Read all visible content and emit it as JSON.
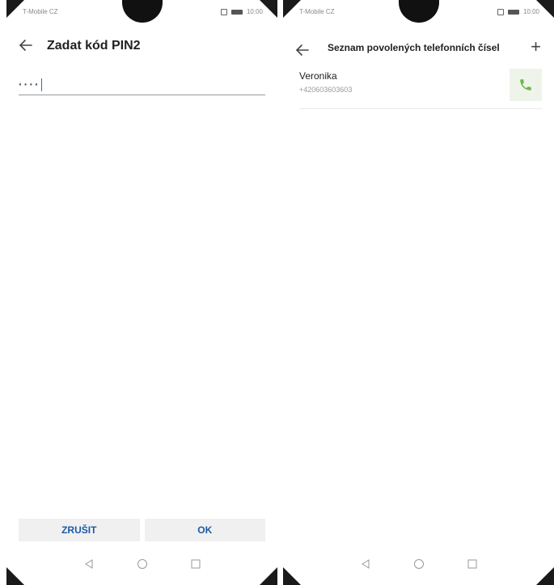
{
  "left": {
    "status": {
      "carrier": "T-Mobile CZ",
      "time": "10:00"
    },
    "appbar": {
      "title": "Zadat kód PIN2"
    },
    "pin_input": {
      "value": "····"
    },
    "buttons": {
      "cancel_label": "ZRUŠIT",
      "ok_label": "OK"
    }
  },
  "right": {
    "status": {
      "carrier": "T-Mobile CZ",
      "time": "10:00"
    },
    "appbar": {
      "title": "Seznam povolených telefonních čísel",
      "add_label": "+"
    },
    "contacts": [
      {
        "name": "Veronika",
        "number": "+420603603603"
      }
    ]
  },
  "colors": {
    "accent": "#1c5aa6",
    "call_green": "#6bb84a",
    "caret": "#1e73c8"
  },
  "icons": {
    "back": "arrow-left-icon",
    "add": "plus-icon",
    "call": "phone-icon",
    "nav_back": "triangle-back-icon",
    "nav_home": "circle-home-icon",
    "nav_recent": "square-recent-icon"
  }
}
